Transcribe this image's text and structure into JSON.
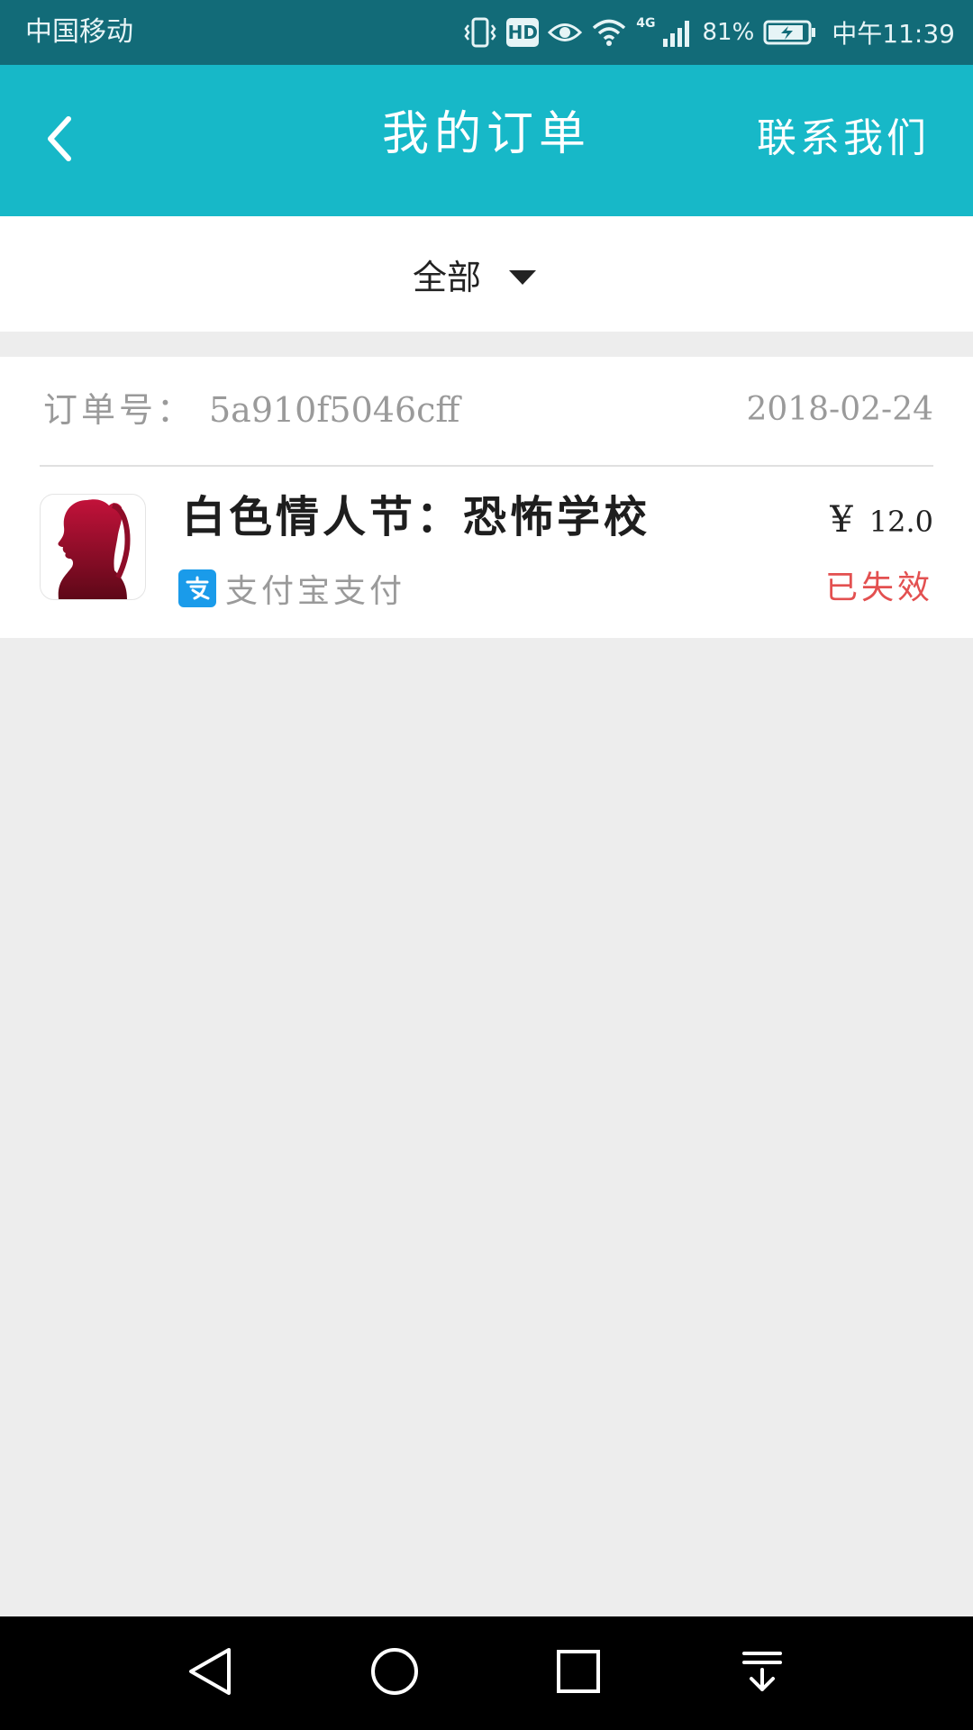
{
  "status_bar": {
    "carrier": "中国移动",
    "hd": "HD",
    "network": "4G",
    "battery": "81%",
    "time": "中午11:39"
  },
  "header": {
    "title": "我的订单",
    "contact": "联系我们"
  },
  "filter": {
    "selected": "全部"
  },
  "orders": [
    {
      "order_no_label": "订单号：",
      "order_no": "5a910f5046cff",
      "date": "2018-02-24",
      "product": "白色情人节：恐怖学校",
      "currency": "¥",
      "price": "12.0",
      "payment_method": "支付宝支付",
      "status": "已失效"
    }
  ],
  "colors": {
    "accent": "#17b8c8",
    "status_bar": "#126b78",
    "expired": "#e35050",
    "alipay": "#1a9bea"
  }
}
